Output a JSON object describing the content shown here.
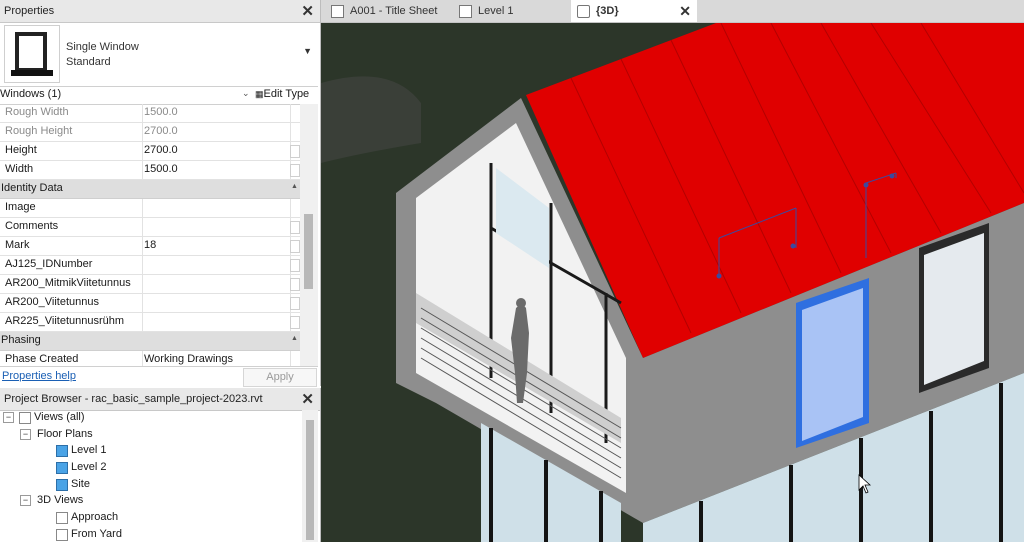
{
  "properties": {
    "title": "Properties",
    "type_name_line1": "Single Window",
    "type_name_line2": "Standard",
    "instance_selector": "Windows (1)",
    "edit_type_label": "Edit Type",
    "rows_top": [
      {
        "name": "Rough Width",
        "value": "1500.0"
      },
      {
        "name": "Rough Height",
        "value": "2700.0"
      },
      {
        "name": "Height",
        "value": "2700.0"
      },
      {
        "name": "Width",
        "value": "1500.0"
      }
    ],
    "group_identity": "Identity Data",
    "rows_identity": [
      {
        "name": "Image",
        "value": ""
      },
      {
        "name": "Comments",
        "value": ""
      },
      {
        "name": "Mark",
        "value": "18"
      },
      {
        "name": "AJ125_IDNumber",
        "value": ""
      },
      {
        "name": "AR200_MitmikViitetunnus",
        "value": ""
      },
      {
        "name": "AR200_Viitetunnus",
        "value": ""
      },
      {
        "name": "AR225_Viitetunnusrühm",
        "value": ""
      }
    ],
    "group_phasing": "Phasing",
    "rows_phasing": [
      {
        "name": "Phase Created",
        "value": "Working Drawings"
      }
    ],
    "help_link": "Properties help",
    "apply_button": "Apply"
  },
  "project_browser": {
    "title": "Project Browser - rac_basic_sample_project-2023.rvt",
    "nodes": [
      {
        "label": "Views (all)"
      },
      {
        "label": "Floor Plans"
      },
      {
        "label": "Level 1"
      },
      {
        "label": "Level 2"
      },
      {
        "label": "Site"
      },
      {
        "label": "3D Views"
      },
      {
        "label": "Approach"
      },
      {
        "label": "From Yard"
      }
    ]
  },
  "tabs": [
    {
      "label": "A001 - Title Sheet"
    },
    {
      "label": "Level 1"
    },
    {
      "label": "{3D}"
    }
  ],
  "colors": {
    "roof": "#e00000",
    "wall": "#8e8e8e",
    "selection": "#2f6fe0",
    "background": "#2c3629"
  }
}
